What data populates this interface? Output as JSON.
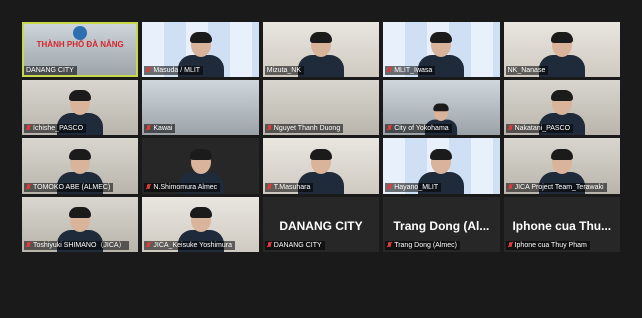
{
  "colors": {
    "active_border": "#c7d84a",
    "muted_icon": "#e23b3b",
    "background": "#1a1a1a"
  },
  "participants": [
    {
      "name": "DANANG CITY",
      "banner": "THÀNH PHỐ ĐÀ NẴNG",
      "active": true,
      "muted": false
    },
    {
      "name": "Masuda / MLIT",
      "muted": true
    },
    {
      "name": "Mizuta_NK",
      "muted": false
    },
    {
      "name": "MLIT_Iwasa",
      "muted": true
    },
    {
      "name": "NK_Nanase",
      "muted": false
    },
    {
      "name": "Ichishe_PASCO",
      "muted": true
    },
    {
      "name": "Kawai",
      "muted": true
    },
    {
      "name": "Nguyet Thanh Duong",
      "muted": true
    },
    {
      "name": "City of Yokohama",
      "muted": true
    },
    {
      "name": "Nakatani_PASCO",
      "muted": true
    },
    {
      "name": "TOMOKO ABE (ALMEC)",
      "muted": true
    },
    {
      "name": "N.Shimomura Almec",
      "muted": true
    },
    {
      "name": "T.Masuhara",
      "muted": true
    },
    {
      "name": "Hayano_MLIT",
      "muted": true
    },
    {
      "name": "JICA Project Team_Terawaki",
      "muted": true
    },
    {
      "name": "Toshiyuki SHIMANO（JICA）",
      "muted": true
    },
    {
      "name": "JICA_Keisuke Yoshimura",
      "muted": true
    },
    {
      "name": "DANANG CITY",
      "big_name": "DANANG CITY",
      "muted": true
    },
    {
      "name": "Trang Dong (Almec)",
      "big_name": "Trang Dong (Al...",
      "muted": true
    },
    {
      "name": "Iphone cua Thuy Pham",
      "big_name": "Iphone cua Thu...",
      "muted": true
    }
  ]
}
